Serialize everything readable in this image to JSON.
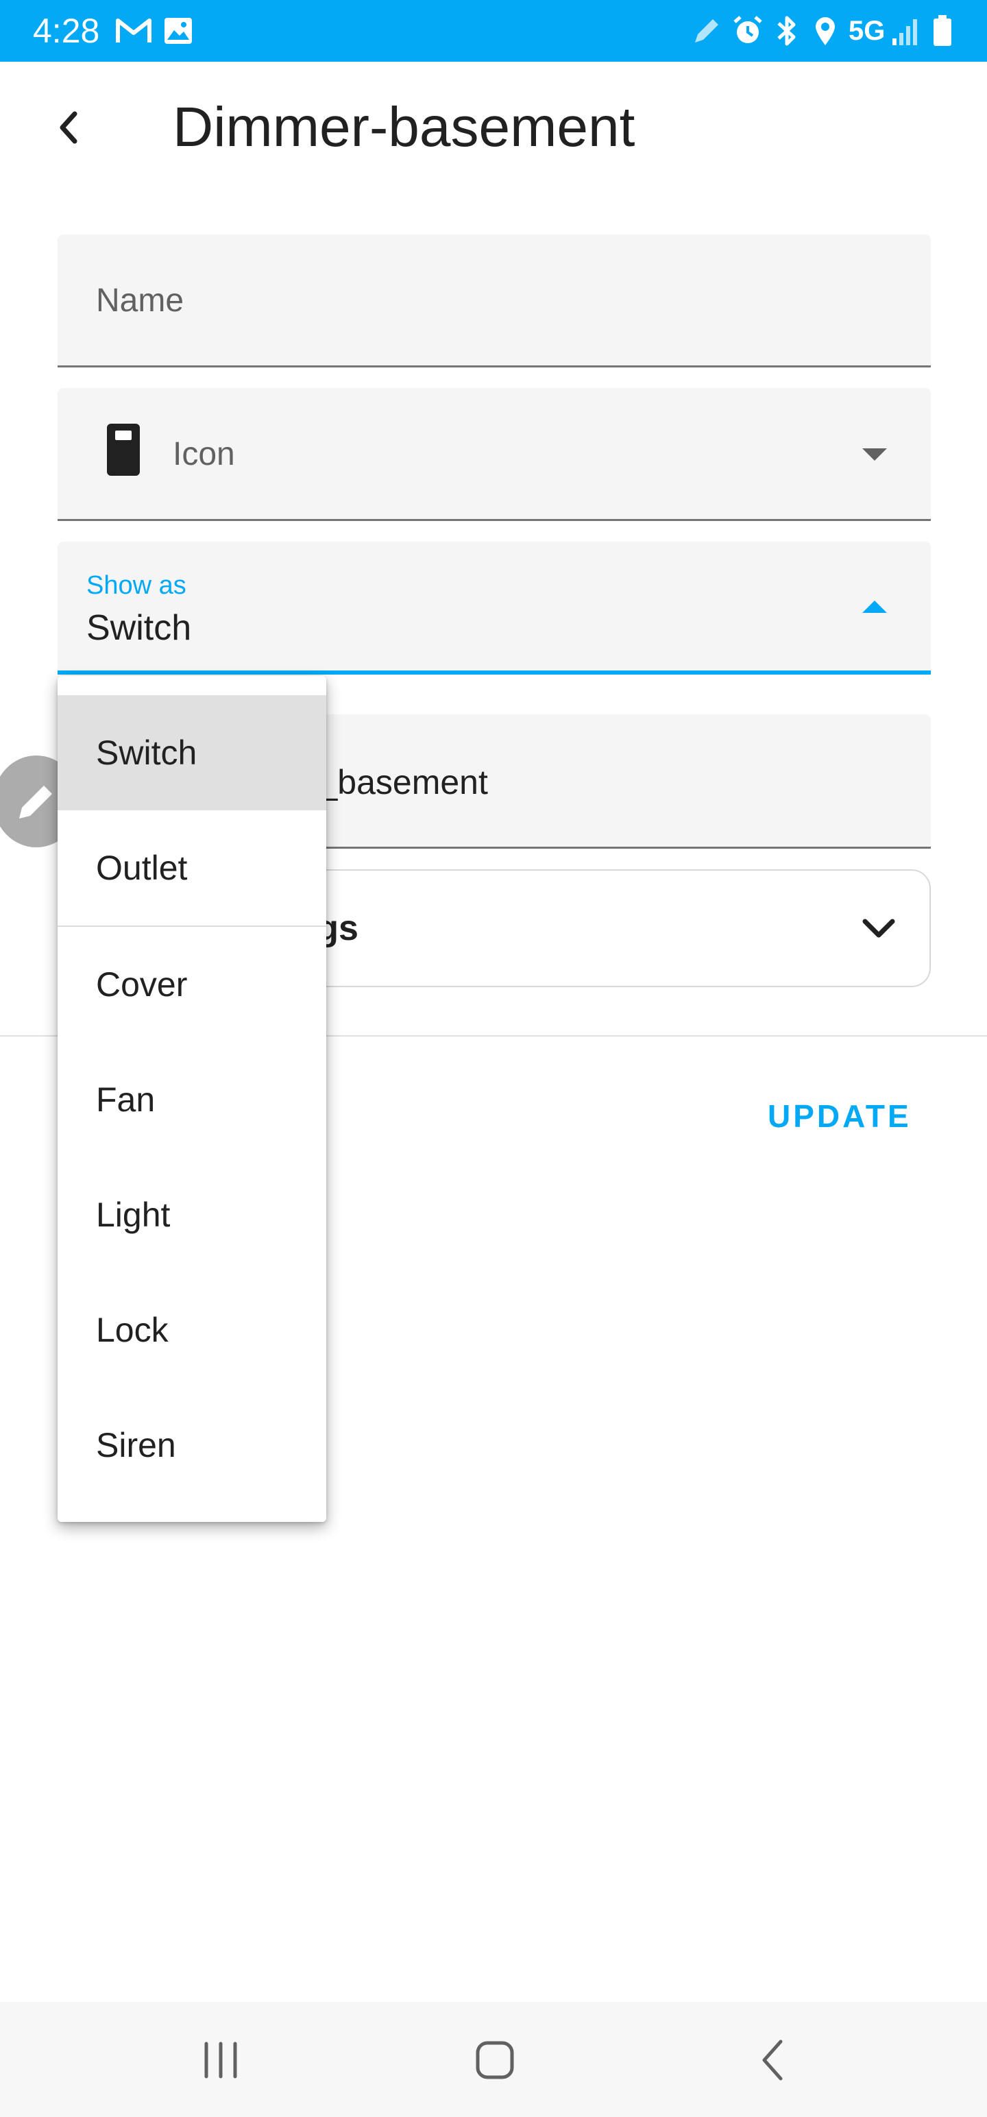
{
  "status_bar": {
    "time": "4:28",
    "network": "5G",
    "left_icons": [
      "gmail-icon",
      "gallery-icon"
    ],
    "right_icons": [
      "pen-icon",
      "alarm-icon",
      "bluetooth-icon",
      "location-icon",
      "signal-icon",
      "battery-icon"
    ],
    "color": "#03a9f4"
  },
  "header": {
    "title": "Dimmer-basement"
  },
  "form": {
    "name_placeholder": "Name",
    "icon_placeholder": "Icon",
    "show_as": {
      "label": "Show as",
      "value": "Switch"
    },
    "entity_id_value": "er_basement",
    "advanced_label": "ings",
    "update_label": "UPDATE"
  },
  "menu": {
    "items": [
      {
        "label": "Switch",
        "selected": true
      },
      {
        "label": "Outlet",
        "selected": false
      },
      {
        "label": "Cover",
        "selected": false
      },
      {
        "label": "Fan",
        "selected": false
      },
      {
        "label": "Light",
        "selected": false
      },
      {
        "label": "Lock",
        "selected": false
      },
      {
        "label": "Siren",
        "selected": false
      }
    ]
  },
  "colors": {
    "accent": "#03a9f4",
    "field_bg": "#f5f5f5",
    "selected_bg": "#e0e0e0"
  }
}
